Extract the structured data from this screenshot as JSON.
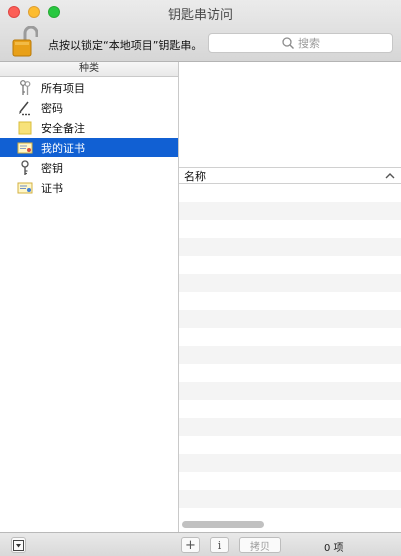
{
  "window": {
    "title": "钥匙串访问"
  },
  "toolbar": {
    "lock_text": "点按以锁定“本地项目”钥匙串。",
    "search_placeholder": "搜索"
  },
  "sidebar": {
    "header": "种类",
    "items": [
      {
        "label": "所有项目",
        "icon": "all-items-icon"
      },
      {
        "label": "密码",
        "icon": "password-icon"
      },
      {
        "label": "安全备注",
        "icon": "secure-note-icon"
      },
      {
        "label": "我的证书",
        "icon": "my-certificate-icon",
        "selected": true
      },
      {
        "label": "密钥",
        "icon": "key-icon"
      },
      {
        "label": "证书",
        "icon": "certificate-icon"
      }
    ]
  },
  "table": {
    "column_name": "名称"
  },
  "bottombar": {
    "add_label": "+",
    "info_label": "i",
    "copy_label": "拷贝",
    "count_label": "0 项"
  },
  "colors": {
    "selection": "#1160d3",
    "stripe": "#f4f4f4"
  }
}
